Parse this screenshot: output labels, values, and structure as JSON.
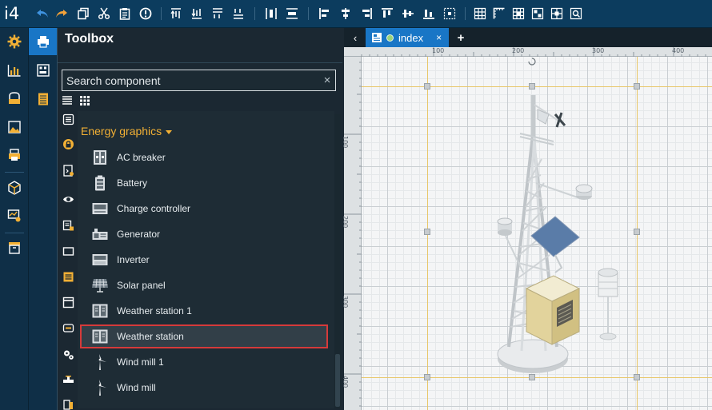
{
  "app": {
    "logo": "i4"
  },
  "toolbox": {
    "title": "Toolbox",
    "search_placeholder": "Search component",
    "search_value": "",
    "clear_symbol": "×",
    "group": {
      "label": "Energy graphics",
      "items": [
        {
          "label": "AC breaker",
          "icon": "ac-breaker-icon"
        },
        {
          "label": "Battery",
          "icon": "battery-icon"
        },
        {
          "label": "Charge controller",
          "icon": "charge-controller-icon"
        },
        {
          "label": "Generator",
          "icon": "generator-icon"
        },
        {
          "label": "Inverter",
          "icon": "inverter-icon"
        },
        {
          "label": "Solar panel",
          "icon": "solar-panel-icon"
        },
        {
          "label": "Weather station 1",
          "icon": "weather-station-icon"
        },
        {
          "label": "Weather station",
          "icon": "weather-station-icon",
          "selected": true
        },
        {
          "label": "Wind mill 1",
          "icon": "wind-mill-icon"
        },
        {
          "label": "Wind mill",
          "icon": "wind-mill-icon"
        }
      ]
    }
  },
  "editor": {
    "tab": {
      "label": "index",
      "close_symbol": "×"
    },
    "nav_symbol": "‹",
    "add_symbol": "+",
    "ruler_x": [
      "100",
      "200",
      "300",
      "400"
    ],
    "ruler_y": [
      "100",
      "200",
      "300",
      "400"
    ]
  },
  "colors": {
    "topbar": "#0c3c5e",
    "toolbar_icon": "#ffffff",
    "undo_redo": "#3f93e0",
    "rail_icon": "#f2b035",
    "active_tab": "#1976c6",
    "group_header": "#f2b035",
    "selected_border": "#d63a3a",
    "guide_line": "#e8c76a"
  }
}
